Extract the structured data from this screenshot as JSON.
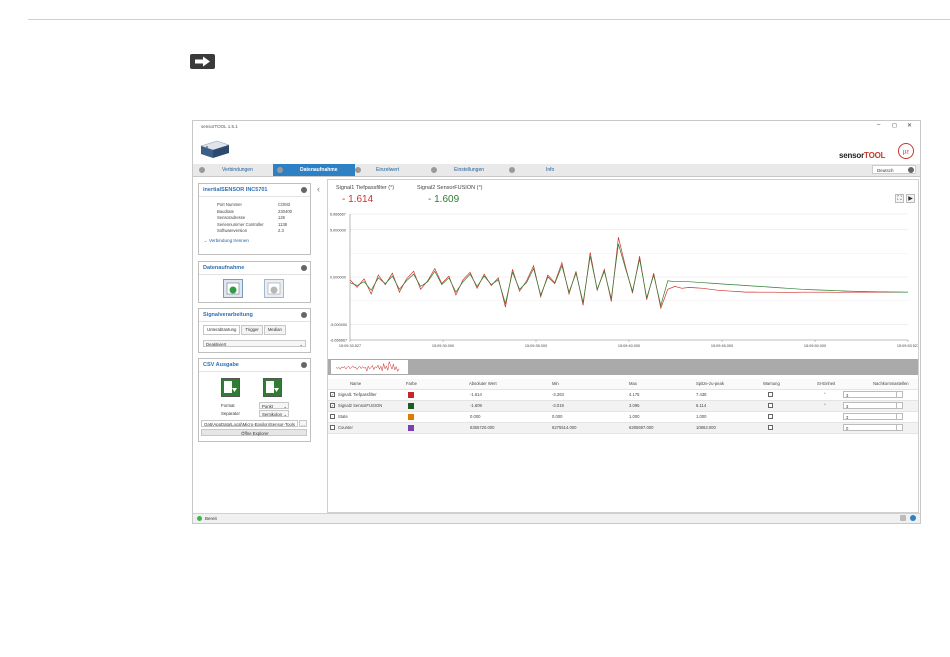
{
  "app": {
    "title": "sensorTOOL 1.5.1",
    "brand_prefix": "sensor",
    "brand_suffix": "TOOL",
    "language": "Deutsch"
  },
  "tabs": [
    {
      "label": "Verbindungen"
    },
    {
      "label": "Datenaufnahme"
    },
    {
      "label": "Einzelwert"
    },
    {
      "label": "Einstellungen"
    },
    {
      "label": "Info"
    }
  ],
  "sensor_panel": {
    "title": "inertialSENSOR INC5701",
    "rows": [
      {
        "k": "Port Nummer",
        "v": "COM3"
      },
      {
        "k": "Baudrate",
        "v": "230400"
      },
      {
        "k": "Sensoradresse",
        "v": "126"
      },
      {
        "k": "Seriennummer Controller",
        "v": "1138"
      },
      {
        "k": "Softwareversion",
        "v": "2.3"
      }
    ],
    "disconnect": "Verbindung trennen"
  },
  "acq_panel": {
    "title": "Datenaufnahme"
  },
  "signal_panel": {
    "title": "Signalverarbeitung",
    "subtabs": [
      "Unterabtastung",
      "Trigger",
      "Median"
    ],
    "select": "Deaktiviert"
  },
  "csv_panel": {
    "title": "CSV Ausgabe",
    "format_label": "Format",
    "format_value": "Punkt",
    "separator_label": "Separator",
    "separator_value": "Semikolon",
    "path": "Oa5\\AppData\\Local\\Micro-Epsilon\\Sensor-Tools",
    "open_button": "Öffne Explorer"
  },
  "signals": [
    {
      "label": "Signal1 Tiefpassfilter (°)",
      "value": "- 1.614",
      "color": "#d0312d"
    },
    {
      "label": "Signal2 SensorFUSION (°)",
      "value": "- 1.609",
      "color": "#2e7d32"
    }
  ],
  "chart_data": {
    "type": "line",
    "y_ticks": [
      "6.666667",
      "5.000000",
      "0.000000",
      "-5.000000",
      "-6.666667"
    ],
    "x_ticks": [
      "15:09:33.527",
      "15:09:30.000",
      "15:09:35.000",
      "15:09:40.000",
      "15:09:45.000",
      "15:09:50.000",
      "15:09:53.527"
    ],
    "ylim": [
      -6.666667,
      6.666667
    ],
    "grid": true,
    "series": [
      {
        "name": "Signal1 Tiefpassfilter",
        "color": "#d0312d",
        "values": [
          -0.3,
          -1.1,
          -0.2,
          -1.8,
          0.2,
          -0.8,
          0.4,
          -1.6,
          -0.2,
          0.6,
          -1.3,
          -0.4,
          0.9,
          -0.7,
          0.1,
          -1.9,
          -0.3,
          0.5,
          -1.2,
          0.3,
          -0.9,
          -0.1,
          -3.2,
          0.8,
          -1.5,
          -0.4,
          1.2,
          -2.1,
          0.2,
          -0.6,
          1.5,
          -1.8,
          0.6,
          -3.0,
          2.6,
          -1.4,
          0.8,
          -2.6,
          4.2,
          1.1,
          -1.7,
          2.2,
          -2.4,
          0.4,
          -3.3,
          -1.3,
          -1.0,
          -1.2,
          -1.1,
          -1.15,
          -1.2,
          -1.3,
          -1.4,
          -1.45,
          -1.5,
          -1.55,
          -1.6,
          -1.6,
          -1.61,
          -1.61,
          -1.61,
          -1.62,
          -1.62,
          -1.62,
          -1.61,
          -1.61,
          -1.61,
          -1.61,
          -1.61,
          -1.62,
          -1.61,
          -1.61,
          -1.61,
          -1.61,
          -1.61,
          -1.61,
          -1.61,
          -1.61,
          -1.61,
          -1.61
        ]
      },
      {
        "name": "Signal2 SensorFUSION",
        "color": "#2e7d32",
        "values": [
          -0.6,
          -0.9,
          -0.5,
          -1.4,
          -0.1,
          -0.7,
          0.1,
          -1.3,
          -0.4,
          0.3,
          -1.0,
          -0.5,
          0.6,
          -0.8,
          -0.1,
          -1.6,
          -0.5,
          0.3,
          -1.0,
          0.1,
          -0.8,
          -0.3,
          -2.8,
          0.5,
          -1.3,
          -0.6,
          0.9,
          -1.9,
          0.0,
          -0.7,
          1.2,
          -1.6,
          0.4,
          -2.7,
          2.2,
          -1.3,
          0.6,
          -2.3,
          3.5,
          0.9,
          -1.5,
          1.9,
          -2.2,
          0.2,
          -3.0,
          -0.4,
          -0.5,
          -0.5,
          -0.5,
          -0.55,
          -0.6,
          -0.65,
          -0.7,
          -0.75,
          -0.8,
          -0.85,
          -0.9,
          -0.95,
          -1.0,
          -1.05,
          -1.1,
          -1.15,
          -1.2,
          -1.25,
          -1.3,
          -1.33,
          -1.36,
          -1.39,
          -1.42,
          -1.45,
          -1.48,
          -1.5,
          -1.52,
          -1.54,
          -1.56,
          -1.57,
          -1.58,
          -1.59,
          -1.6,
          -1.609
        ]
      }
    ]
  },
  "table": {
    "headers": [
      "Name",
      "Farbe",
      "Absoluter Wert",
      "Min",
      "Max",
      "Spitze-zu-peak",
      "Warnung",
      "SI-Einheit",
      "Nachkommastellen"
    ],
    "rows": [
      {
        "name": "Signal1 Tiefpassfilter",
        "color": "#c62828",
        "abs": "-1.614",
        "min": "-3.263",
        "max": "4.175",
        "p2p": "7.438",
        "unit": "°",
        "dec": "3",
        "checked": true
      },
      {
        "name": "Signal2 SensorFUSION",
        "color": "#1b5e20",
        "abs": "-1.609",
        "min": "-3.019",
        "max": "3.095",
        "p2p": "6.114",
        "unit": "°",
        "dec": "3",
        "checked": true
      },
      {
        "name": "State",
        "color": "#e07b00",
        "abs": "0.000",
        "min": "0.000",
        "max": "1.000",
        "p2p": "1.000",
        "unit": "",
        "dec": "3",
        "checked": false
      },
      {
        "name": "Counter",
        "color": "#7b3fb5",
        "abs": "6355720.000",
        "min": "6275514.000",
        "max": "6285697.000",
        "p2p": "10863.000",
        "unit": "",
        "dec": "0",
        "checked": false
      }
    ]
  },
  "status": {
    "text": "Bereit"
  }
}
